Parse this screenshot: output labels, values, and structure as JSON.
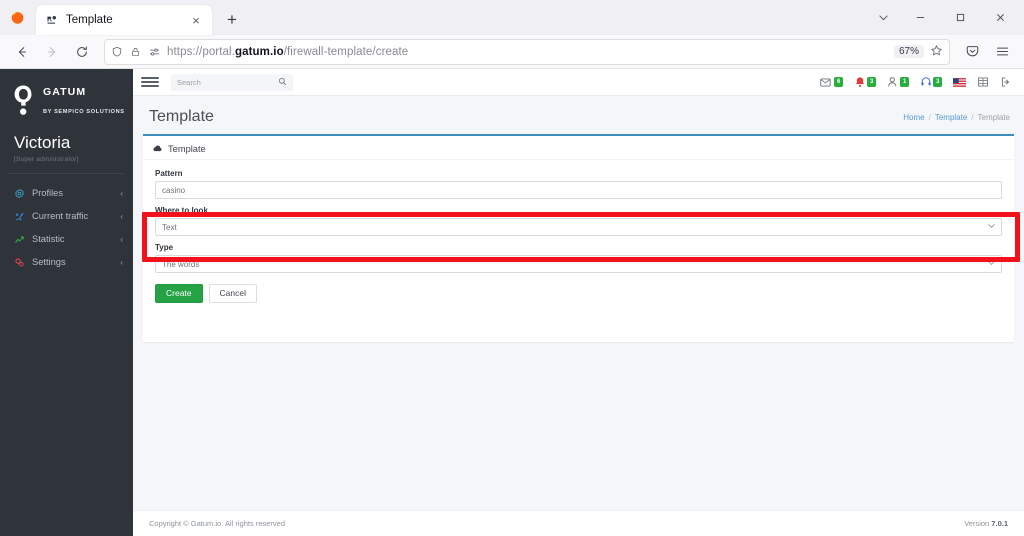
{
  "browser": {
    "tab": {
      "title": "Template",
      "favicon": "gatum-favicon",
      "close_label": "×"
    },
    "new_tab_label": "+",
    "window": {
      "tablist": "chevron-down-icon",
      "minimize": "−",
      "maximize": "❐",
      "close": "✕"
    },
    "nav": {
      "back": "←",
      "forward": "→",
      "reload": "↻"
    },
    "url": {
      "scheme_prefix": "https://portal.",
      "host": "gatum.io",
      "path": "/firewall-template/create"
    },
    "zoom_level": "67%",
    "icons": {
      "shield": "shield-icon",
      "lock": "lock-icon",
      "permissions": "permissions-icon",
      "bookmark": "star-icon",
      "pocket": "pocket-icon",
      "menu": "hamburger-menu-icon"
    }
  },
  "sidebar": {
    "brand": {
      "name": "GATUM",
      "sub": "BY SEMPICO SOLUTIONS",
      "logo": "gatum-logo"
    },
    "user": {
      "name": "Victoria",
      "role": "[Super administrator]"
    },
    "items": [
      {
        "label": "Profiles",
        "icon": "profiles-icon",
        "color": "#3ba9dd",
        "chevron": "‹"
      },
      {
        "label": "Current traffic",
        "icon": "traffic-icon",
        "color": "#3b7fdd",
        "chevron": "‹"
      },
      {
        "label": "Statistic",
        "icon": "statistic-icon",
        "color": "#35b24a",
        "chevron": "‹"
      },
      {
        "label": "Settings",
        "icon": "settings-icon",
        "color": "#e2424a",
        "chevron": "‹"
      }
    ]
  },
  "topbar": {
    "menu_toggle": "hamburger-icon",
    "search": {
      "placeholder": "Search",
      "value": "",
      "icon": "search-icon"
    },
    "icons": [
      {
        "name": "messages-icon",
        "badge": "6"
      },
      {
        "name": "notifications-icon",
        "badge": "3"
      },
      {
        "name": "users-icon",
        "badge": "1"
      },
      {
        "name": "support-icon",
        "badge": "3"
      },
      {
        "name": "flag-us-icon",
        "badge": ""
      },
      {
        "name": "apps-grid-icon",
        "badge": ""
      },
      {
        "name": "logout-icon",
        "badge": ""
      }
    ],
    "badge_color": "#27ae3f"
  },
  "page": {
    "title": "Template",
    "breadcrumb": [
      {
        "label": "Home",
        "link": true
      },
      {
        "label": "Template",
        "link": true
      },
      {
        "label": "Template",
        "link": false
      }
    ],
    "breadcrumb_separator": "/"
  },
  "card": {
    "header": {
      "title": "Template",
      "icon": "cloud-upload-icon"
    },
    "accent_color": "#3c8dbc",
    "fields": [
      {
        "label": "Pattern",
        "type": "input",
        "value": "casino"
      },
      {
        "label": "Where to look",
        "type": "select",
        "value": "Text",
        "highlighted": true
      },
      {
        "label": "Type",
        "type": "select",
        "value": "The words",
        "highlighted": false
      }
    ],
    "buttons": {
      "create": "Create",
      "cancel": "Cancel",
      "create_color": "#25a244"
    },
    "highlight_color": "#f3121b"
  },
  "footer": {
    "copyright": "Copyright © Gatum.io. All rights reserved",
    "version_label": "Version",
    "version_number": "7.0.1"
  }
}
